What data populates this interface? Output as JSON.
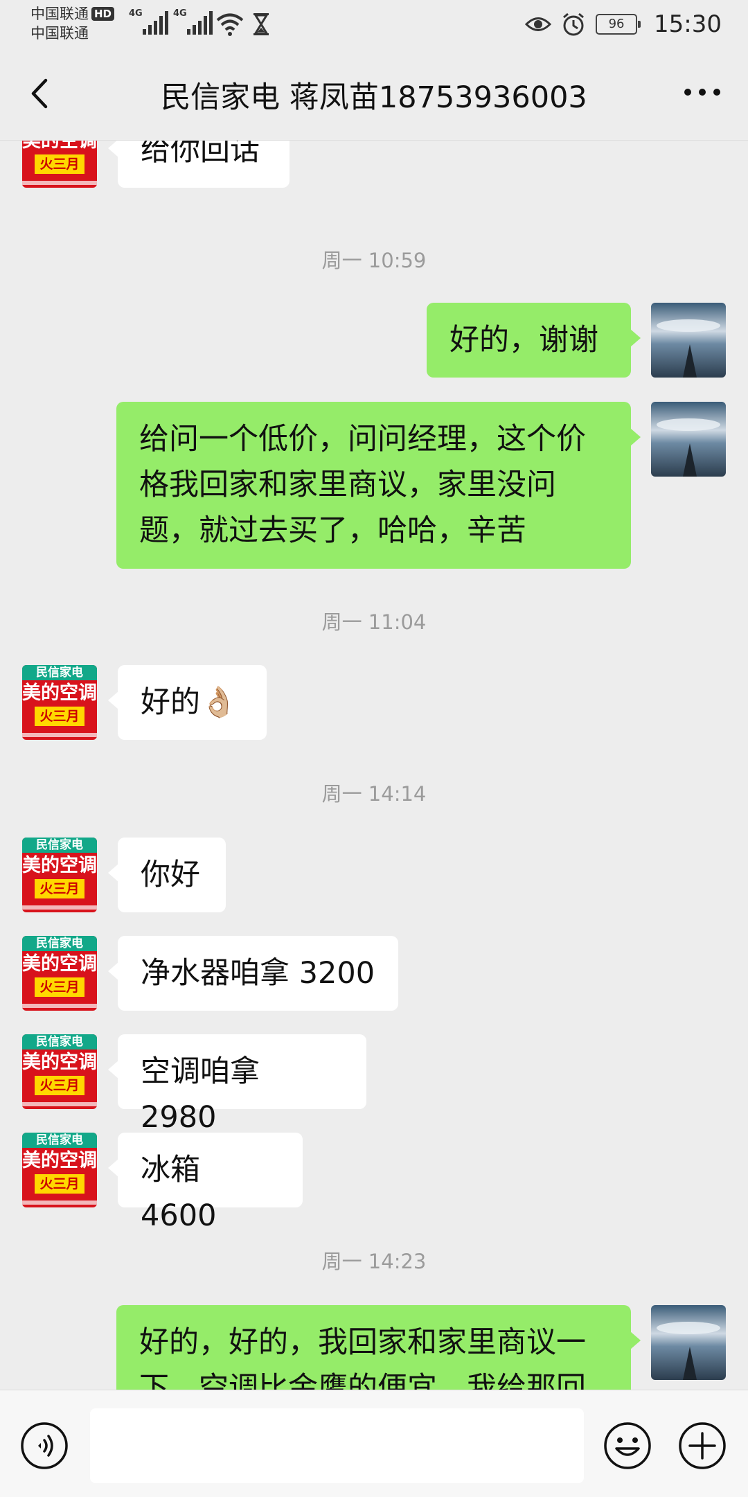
{
  "status_bar": {
    "carrier1": "中国联通",
    "carrier2": "中国联通",
    "hd": "HD",
    "net1": "4G",
    "net2": "4G",
    "battery": "96",
    "time": "15:30"
  },
  "header": {
    "title": "民信家电 蒋凤苗18753936003"
  },
  "shop_avatar": {
    "top": "民信家电",
    "mid": "美的空调",
    "box": "火三月"
  },
  "messages": [
    {
      "type": "in",
      "text": "给你回话"
    },
    {
      "type": "time",
      "text": "周一 10:59"
    },
    {
      "type": "out",
      "text": "好的，谢谢"
    },
    {
      "type": "out",
      "text": "给问一个低价，问问经理，这个价格我回家和家里商议，家里没问题，就过去买了，哈哈，辛苦"
    },
    {
      "type": "time",
      "text": "周一 11:04"
    },
    {
      "type": "in",
      "text": "好的👌🏼"
    },
    {
      "type": "time",
      "text": "周一 14:14"
    },
    {
      "type": "in",
      "text": "你好"
    },
    {
      "type": "in",
      "text": "净水器咱拿 3200"
    },
    {
      "type": "in",
      "text": "空调咱拿 2980"
    },
    {
      "type": "in",
      "text": "冰箱 4600"
    },
    {
      "type": "time",
      "text": "周一 14:23"
    },
    {
      "type": "out",
      "text": "好的，好的，我回家和家里商议一下，空调比金鹰的便宜，我给那回"
    }
  ],
  "input": {
    "placeholder": ""
  }
}
